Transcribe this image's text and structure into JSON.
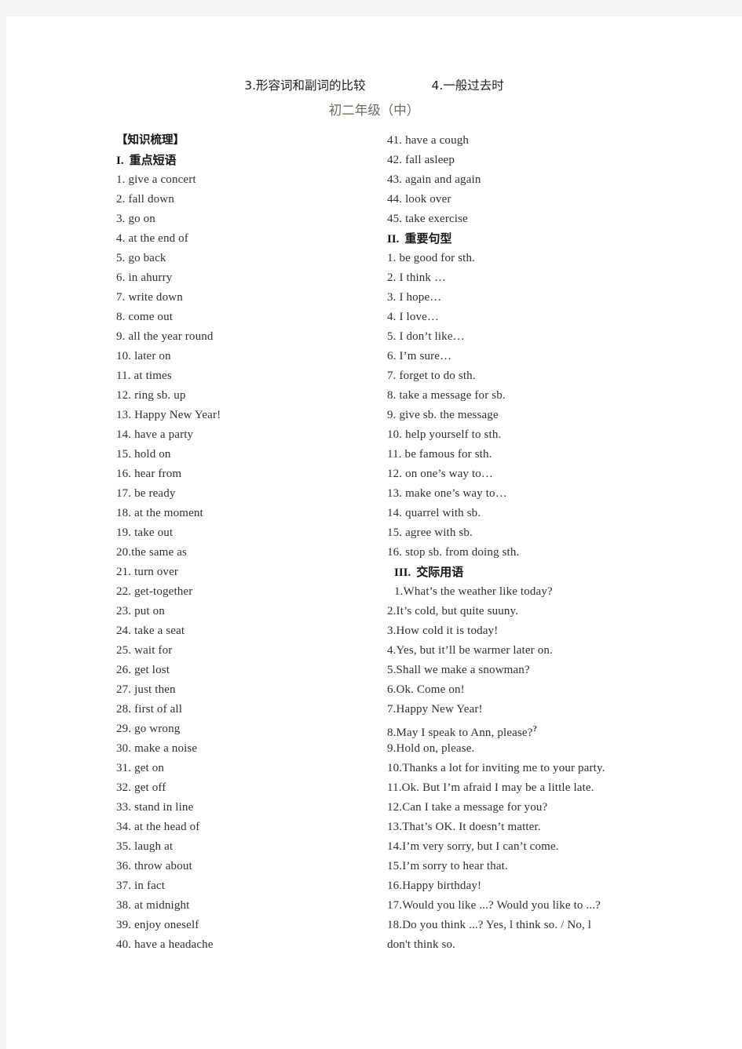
{
  "header": {
    "title_left": "3.形容词和副词的比较",
    "title_right": "4.一般过去时",
    "subtitle": "初二年级（中）"
  },
  "left_column": {
    "section_bracket": "【知识梳理】",
    "section_roman": "I.",
    "section_title": "重点短语",
    "items": [
      "1. give a concert",
      "2. fall down",
      "3. go on",
      "4. at the end of",
      "5. go back",
      "6. in ahurry",
      "7. write down",
      "8. come out",
      "9. all the year round",
      "10. later on",
      "11. at times",
      "12. ring sb. up",
      "13. Happy New Year!",
      "14. have a party",
      "15. hold on",
      "16. hear from",
      "17. be ready",
      "18. at the moment",
      "19. take out",
      "20.the same as",
      "21. turn over",
      "22. get-together",
      "23. put on",
      "24. take a seat",
      "25. wait for",
      "26. get lost",
      "27. just then",
      "28. first of all",
      "29. go wrong",
      "30. make a noise",
      "31. get on",
      "32. get off",
      "33. stand in line",
      "34. at the head of",
      "35. laugh at",
      "36. throw about",
      "37. in fact",
      "38. at midnight",
      "39. enjoy oneself",
      "40. have a headache"
    ]
  },
  "right_column": {
    "phrases_continued": [
      "41. have a cough",
      "42. fall asleep",
      "43. again and again",
      "44. look over",
      "45. take exercise"
    ],
    "section2_roman": "II.",
    "section2_title": "重要句型",
    "section2_items": [
      "1. be good for sth.",
      "2. I think …",
      "3. I hope…",
      "4. I love…",
      "5. I don’t like…",
      "6. I’m sure…",
      "7. forget to do sth.",
      "8. take a message for sb.",
      "9. give sb. the message",
      "10. help yourself to sth.",
      "11. be famous for sth.",
      "12. on one’s way to…",
      "13. make one’s way to…",
      "14. quarrel with sb.",
      "15. agree with sb.",
      "16. stop sb. from doing sth."
    ],
    "section3_roman": "III.",
    "section3_title": "交际用语",
    "section3_items": [
      "1.What’s the weather like today?",
      "2.It’s cold, but quite suuny.",
      "3.How cold it is today!",
      "4.Yes, but it’ll be warmer later on.",
      "5.Shall we make a snowman?",
      "6.Ok. Come on!",
      "7.Happy New Year!",
      "8.May I speak to Ann, please?",
      "9.Hold on, please.",
      "10.Thanks a lot for inviting me to your party.",
      "11.Ok. But I’m afraid I may be a little late.",
      "12.Can I take a message for you?",
      "13.That’s OK. It doesn’t matter.",
      "14.I’m very sorry, but I can’t come.",
      "15.I’m sorry to hear that.",
      "16.Happy birthday!",
      "17.Would you like ...? Would you like to ...?",
      "18.Do you think ...? Yes, l think so. / No, l",
      "don't think so."
    ],
    "item8_superscript": "?"
  }
}
